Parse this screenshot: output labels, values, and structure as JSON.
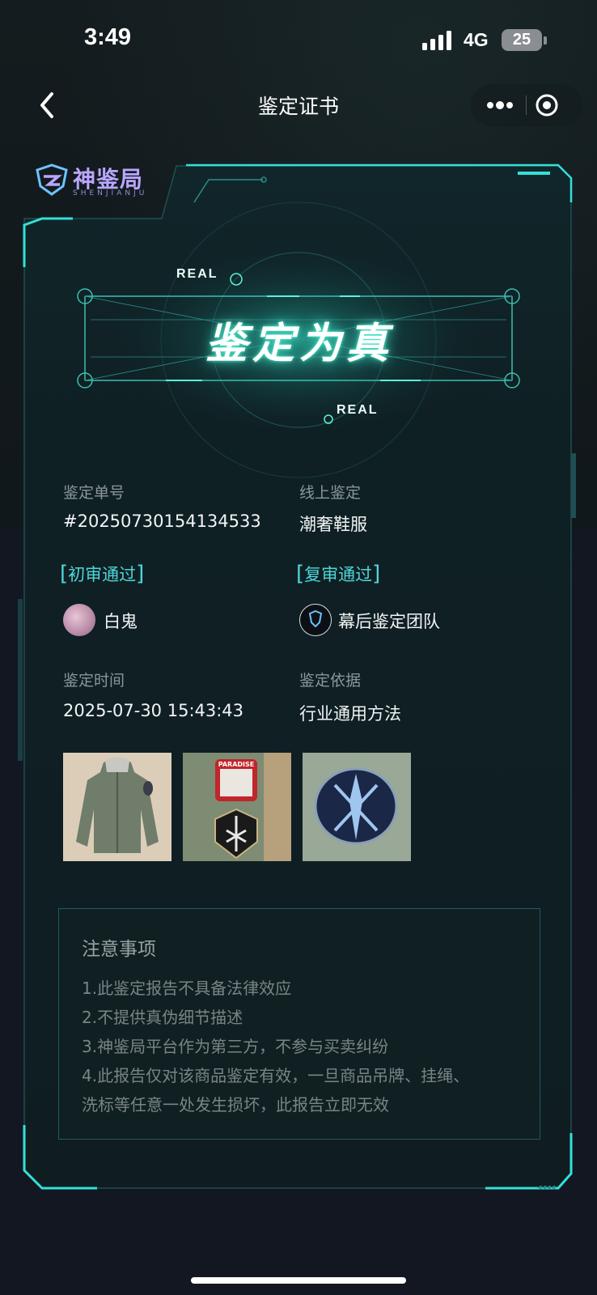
{
  "status_bar": {
    "time": "3:49",
    "network": "4G",
    "battery": "25"
  },
  "nav": {
    "title": "鉴定证书",
    "back_icon": "chevron-left-icon",
    "more_icon": "more-dots-icon",
    "close_icon": "target-circle-icon"
  },
  "brand": {
    "name": "神鉴局",
    "subtitle": "SHENJIANJU"
  },
  "verdict": {
    "result": "鉴定为真",
    "tag_top": "REAL",
    "tag_bottom": "REAL"
  },
  "info": {
    "order_label": "鉴定单号",
    "order_value": "#20250730154134533",
    "type_label": "线上鉴定",
    "type_value": "潮奢鞋服",
    "first_review": {
      "status": "初审通过",
      "reviewer": "白鬼"
    },
    "second_review": {
      "status": "复审通过",
      "reviewer": "幕后鉴定团队"
    },
    "time_label": "鉴定时间",
    "time_value": "2025-07-30 15:43:43",
    "basis_label": "鉴定依据",
    "basis_value": "行业通用方法"
  },
  "photos": {
    "patch_text": "PARADISE"
  },
  "notice": {
    "title": "注意事项",
    "lines": [
      "1.此鉴定报告不具备法律效应",
      "2.不提供真伪细节描述",
      "3.神鉴局平台作为第三方，不参与买卖纠纷",
      "4.此报告仅对该商品鉴定有效，一旦商品吊牌、挂绳、",
      "洗标等任意一处发生损坏，此报告立即无效"
    ]
  },
  "colors": {
    "accent": "#4ed6d8",
    "frame": "#2fd7d2",
    "background_top": "#12191c",
    "background_bottom": "#121722"
  }
}
